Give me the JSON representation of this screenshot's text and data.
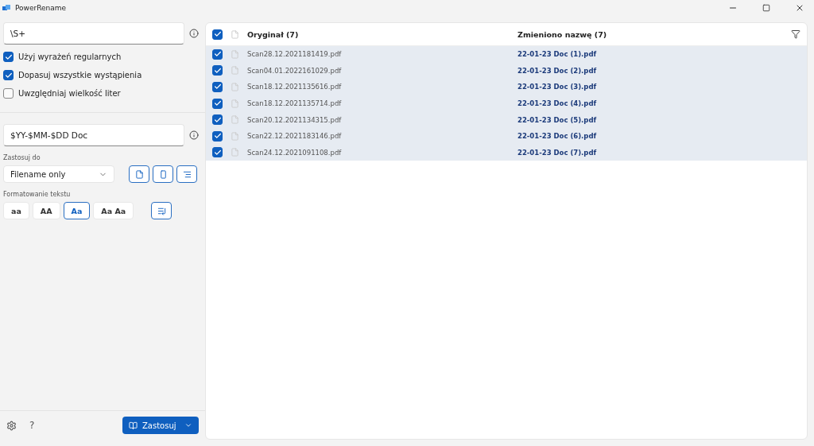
{
  "window": {
    "title": "PowerRename"
  },
  "search": {
    "value": "\\S+"
  },
  "options": [
    {
      "label": "Użyj wyrażeń regularnych",
      "checked": true
    },
    {
      "label": "Dopasuj wszystkie wystąpienia",
      "checked": true
    },
    {
      "label": "Uwzględniaj wielkość liter",
      "checked": false
    }
  ],
  "replace": {
    "value": "$YY-$MM-$DD Doc"
  },
  "apply_to": {
    "label": "Zastosuj do",
    "value": "Filename only",
    "toggles": [
      {
        "kind": "file",
        "on": true
      },
      {
        "kind": "folder",
        "on": true
      },
      {
        "kind": "subfolder",
        "on": true
      }
    ]
  },
  "text_formatting": {
    "label": "Formatowanie tekstu",
    "options": [
      {
        "label": "aa",
        "selected": false
      },
      {
        "label": "AA",
        "selected": false
      },
      {
        "label": "Aa",
        "selected": true
      },
      {
        "label": "Aa Aa",
        "selected": false
      }
    ],
    "enumerate": {
      "on": true
    }
  },
  "footer": {
    "help": "?",
    "apply_button": "Zastosuj"
  },
  "table": {
    "all_checked": true,
    "columns": [
      "Oryginał (7)",
      "Zmieniono nazwę (7)"
    ],
    "rows": [
      {
        "checked": true,
        "original": "Scan28.12.2021181419.pdf",
        "renamed": "22-01-23 Doc (1).pdf"
      },
      {
        "checked": true,
        "original": "Scan04.01.2022161029.pdf",
        "renamed": "22-01-23 Doc (2).pdf"
      },
      {
        "checked": true,
        "original": "Scan18.12.2021135616.pdf",
        "renamed": "22-01-23 Doc (3).pdf"
      },
      {
        "checked": true,
        "original": "Scan18.12.2021135714.pdf",
        "renamed": "22-01-23 Doc (4).pdf"
      },
      {
        "checked": true,
        "original": "Scan20.12.2021134315.pdf",
        "renamed": "22-01-23 Doc (5).pdf"
      },
      {
        "checked": true,
        "original": "Scan22.12.2021183146.pdf",
        "renamed": "22-01-23 Doc (6).pdf"
      },
      {
        "checked": true,
        "original": "Scan24.12.2021091108.pdf",
        "renamed": "22-01-23 Doc (7).pdf"
      }
    ]
  }
}
